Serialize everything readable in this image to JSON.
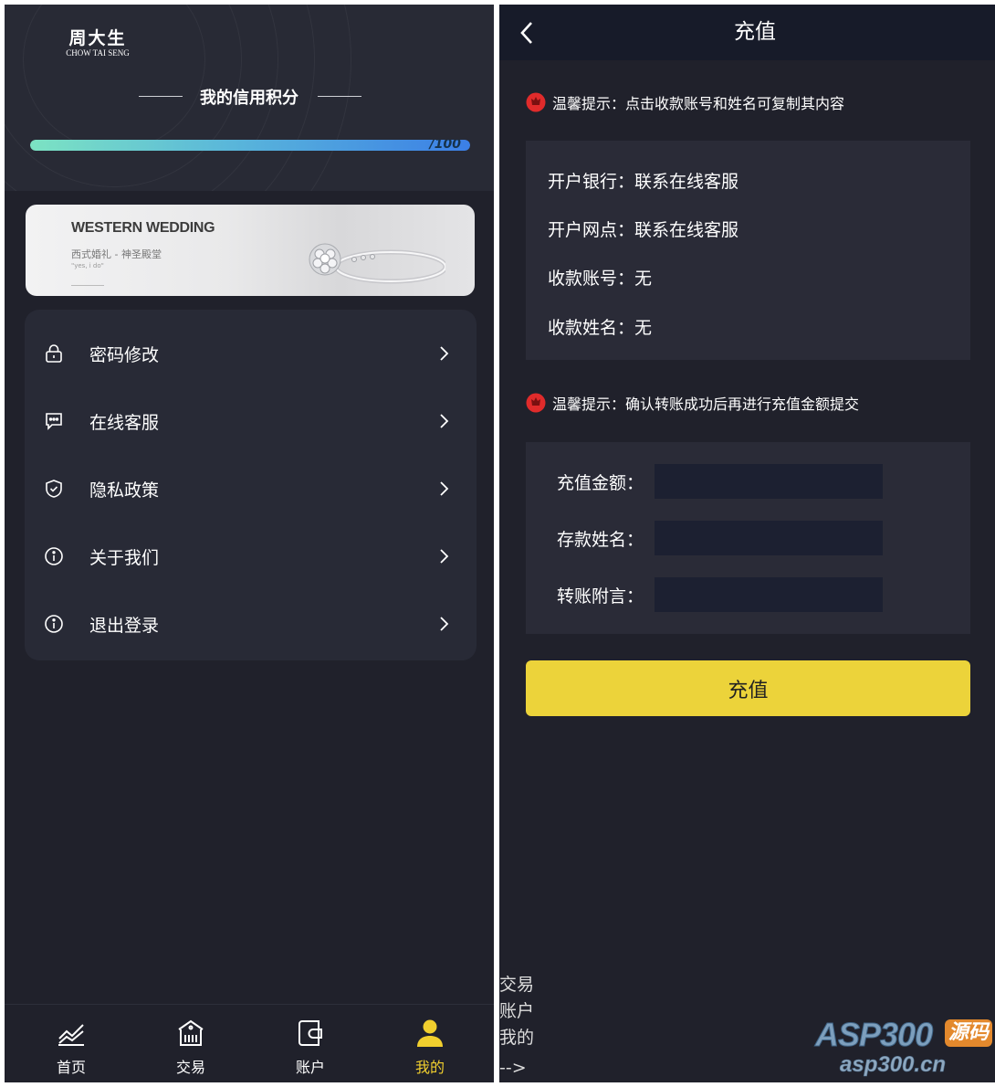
{
  "left": {
    "brand": {
      "cn": "周大生",
      "en": "CHOW TAI SENG"
    },
    "credit": {
      "title": "我的信用积分",
      "progress_label": "/100",
      "progress_fraction": 1.0
    },
    "banner": {
      "title": "WESTERN WEDDING",
      "subtitle": "西式婚礼 - 神圣殿堂",
      "tagline": "\"yes, i do\""
    },
    "menu": [
      {
        "label": "密码修改",
        "icon": "lock-icon"
      },
      {
        "label": "在线客服",
        "icon": "chat-icon"
      },
      {
        "label": "隐私政策",
        "icon": "shield-icon"
      },
      {
        "label": "关于我们",
        "icon": "info-icon"
      },
      {
        "label": "退出登录",
        "icon": "info-icon"
      }
    ],
    "tabs": [
      {
        "label": "首页",
        "icon": "chart-icon"
      },
      {
        "label": "交易",
        "icon": "bank-icon"
      },
      {
        "label": "账户",
        "icon": "wallet-icon"
      },
      {
        "label": "我的",
        "icon": "user-icon"
      }
    ],
    "colors": {
      "active_tab": "#f1cf2e",
      "background": "#20212b"
    }
  },
  "right": {
    "header": {
      "title": "充值"
    },
    "tip1": "温馨提示：点击收款账号和姓名可复制其内容",
    "bank": [
      {
        "label": "开户银行：",
        "value": "联系在线客服"
      },
      {
        "label": "开户网点：",
        "value": "联系在线客服"
      },
      {
        "label": "收款账号：",
        "value": "无"
      },
      {
        "label": "收款姓名：",
        "value": "无"
      }
    ],
    "tip2": "温馨提示：确认转账成功后再进行充值金额提交",
    "form": [
      {
        "label": "充值金额：",
        "value": ""
      },
      {
        "label": "存款姓名：",
        "value": ""
      },
      {
        "label": "转账附言：",
        "value": ""
      }
    ],
    "submit_label": "充值",
    "leaked_text": [
      "交易",
      "账户",
      "我的",
      "-->"
    ],
    "colors": {
      "button": "#ecd33a",
      "tip_icon": "#e02b2b"
    }
  },
  "watermark": {
    "brand": "ASP300",
    "tag": "源码",
    "domain": "asp300.cn"
  }
}
